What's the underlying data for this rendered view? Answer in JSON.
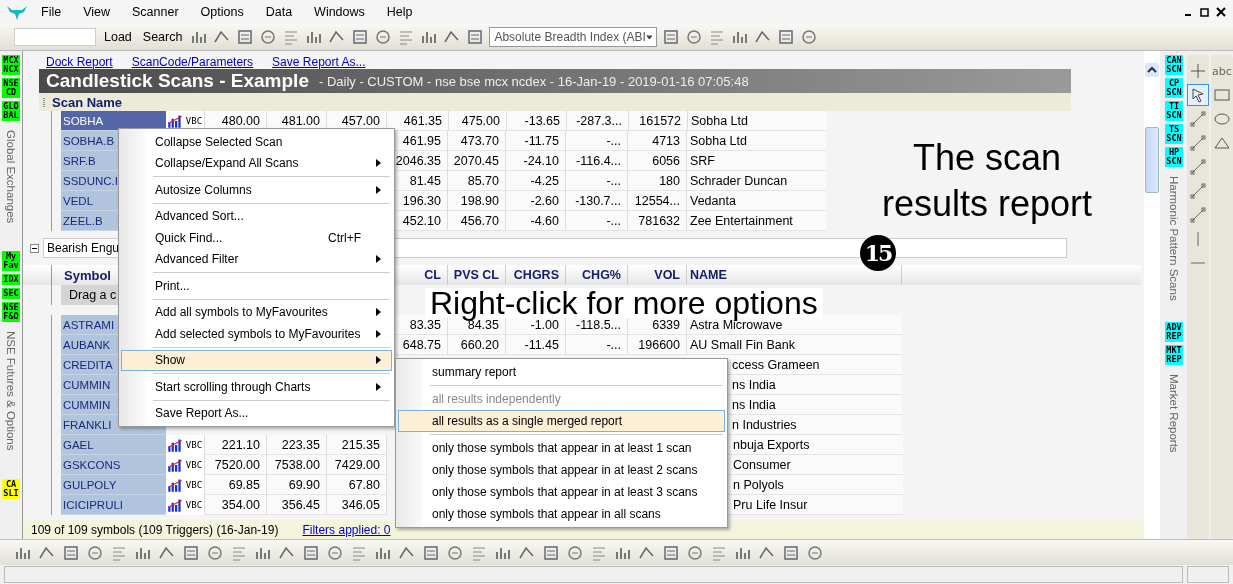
{
  "menu_bar": {
    "items": [
      "File",
      "View",
      "Scanner",
      "Options",
      "Data",
      "Windows",
      "Help"
    ]
  },
  "toolbar": {
    "buttons": [
      "Load",
      "Search"
    ],
    "indicator_dropdown": {
      "value": "Absolute Breadth Index (ABI"
    }
  },
  "left_panel": {
    "groups": [
      {
        "buttons": [
          {
            "label": "MCX NCX",
            "color": "#00ff00"
          },
          {
            "label": "NSE CD",
            "color": "#00ff00"
          },
          {
            "label": "GLO BAL",
            "color": "#00ff00"
          }
        ],
        "caption": "Global Exchanges"
      },
      {
        "buttons": [
          {
            "label": "My Fav",
            "color": "#00ff00"
          },
          {
            "label": "IDX",
            "color": "#00ff00"
          },
          {
            "label": "SEC",
            "color": "#00ff00"
          },
          {
            "label": "NSE F&O",
            "color": "#00ff00"
          }
        ],
        "caption": "NSE Futures & Options"
      },
      {
        "buttons": [
          {
            "label": "CA SLI",
            "color": "#ffff00"
          }
        ]
      }
    ]
  },
  "report": {
    "links": [
      "Dock Report",
      "ScanCode/Parameters",
      "Save Report As..."
    ],
    "title": "Candlestick Scans - Example",
    "subtitle": "- Daily - CUSTOM - nse bse mcx ncdex - 16-Jan-19 - 2019-01-16 07:05:48",
    "column_header": "Scan Name",
    "first_group": {
      "rows": [
        {
          "symbol": "SOBHA",
          "selected": true,
          "chart_link": "VBC",
          "o": "480.00",
          "h": "481.00",
          "l": "457.00",
          "cl": "461.35",
          "pvs": "475.00",
          "chg": "-13.65",
          "pct": "-287.3...",
          "vol": "161572",
          "name": "Sobha Ltd"
        },
        {
          "symbol": "SOBHA.B",
          "selected": false,
          "cl": "461.95",
          "pvs": "473.70",
          "chg": "-11.75",
          "pct": "-...",
          "vol": "4713",
          "name": "Sobha Ltd"
        },
        {
          "symbol": "SRF.B",
          "selected": false,
          "cl": "2046.35",
          "pvs": "2070.45",
          "chg": "-24.10",
          "pct": "-116.4...",
          "vol": "6056",
          "name": "SRF"
        },
        {
          "symbol": "SSDUNC.I",
          "selected": false,
          "cl": "81.45",
          "pvs": "85.70",
          "chg": "-4.25",
          "pct": "-...",
          "vol": "180",
          "name": "Schrader Duncan"
        },
        {
          "symbol": "VEDL",
          "selected": false,
          "cl": "196.30",
          "pvs": "198.90",
          "chg": "-2.60",
          "pct": "-130.7...",
          "vol": "12554...",
          "name": "Vedanta"
        },
        {
          "symbol": "ZEEL.B",
          "selected": false,
          "cl": "452.10",
          "pvs": "456.70",
          "chg": "-4.60",
          "pct": "-...",
          "vol": "781632",
          "name": "Zee Entertainment"
        }
      ]
    },
    "second_group": {
      "title": "Bearish Engu",
      "expanded": true,
      "symbol_header": "Symbol",
      "columns": [
        "CL",
        "PVS CL",
        "CHGRS",
        "CHG%",
        "VOL",
        "NAME"
      ],
      "drag_hint": "Drag a c",
      "rows": [
        {
          "symbol": "ASTRAMI",
          "selected": false,
          "cl": "83.35",
          "pvs": "84.35",
          "chg": "-1.00",
          "pct": "-118.5...",
          "vol": "6339",
          "name": "Astra Microwave"
        },
        {
          "symbol": "AUBANK",
          "selected": false,
          "cl": "648.75",
          "pvs": "660.20",
          "chg": "-11.45",
          "pct": "-...",
          "vol": "196600",
          "name": "AU Small Fin Bank"
        },
        {
          "symbol": "CREDITA",
          "selected": false,
          "name": "ccess Grameen"
        },
        {
          "symbol": "CUMMIN",
          "selected": false,
          "name": "ns India"
        },
        {
          "symbol": "CUMMIN",
          "selected": false,
          "name": "ns India"
        },
        {
          "symbol": "FRANKLI",
          "selected": false,
          "name": "n Industries"
        },
        {
          "symbol": "GAEL",
          "selected": false,
          "chart_link": "VBC",
          "o": "221.10",
          "h": "223.35",
          "l": "215.35",
          "name": "nbuja Exports"
        },
        {
          "symbol": "GSKCONS",
          "selected": false,
          "chart_link": "VBC",
          "o": "7520.00",
          "h": "7538.00",
          "l": "7429.00",
          "name": "Consumer"
        },
        {
          "symbol": "GULPOLY",
          "selected": false,
          "chart_link": "VBC",
          "o": "69.85",
          "h": "69.90",
          "l": "67.80",
          "name": "n Polyols"
        },
        {
          "symbol": "ICICIPRULI",
          "selected": false,
          "chart_link": "VBC",
          "o": "354.00",
          "h": "356.45",
          "l": "346.05",
          "name": "Pru Life Insur"
        }
      ]
    },
    "status": {
      "summary": "109 of 109 symbols (109 Triggers) (16-Jan-19)",
      "filter_link": "Filters applied: 0"
    }
  },
  "right_panel": {
    "scan_tabs": [
      {
        "label": "CAN SCN",
        "color": "#00ffff"
      },
      {
        "label": "CP SCN",
        "color": "#00ffff"
      },
      {
        "label": "TI SCN",
        "color": "#00ffff"
      },
      {
        "label": "TS SCN",
        "color": "#00ffff"
      },
      {
        "label": "HP SCN",
        "color": "#00ffff"
      }
    ],
    "scan_caption": "Harmonic Pattern Scans",
    "report_tabs": [
      {
        "label": "ADV REP",
        "color": "#00ffff"
      },
      {
        "label": "MKT REP",
        "color": "#00ffff"
      }
    ],
    "report_caption": "Market Reports",
    "tools": [
      {
        "kind": "plus",
        "selected": false
      },
      {
        "kind": "pointer",
        "selected": true
      },
      {
        "kind": "line",
        "selected": false
      },
      {
        "kind": "line",
        "selected": false
      },
      {
        "kind": "line",
        "selected": false
      },
      {
        "kind": "line",
        "selected": false
      },
      {
        "kind": "line",
        "selected": false
      },
      {
        "kind": "vline",
        "selected": false
      },
      {
        "kind": "hline",
        "selected": false
      }
    ],
    "shape_tools": [
      {
        "kind": "text",
        "label": "abc"
      },
      {
        "kind": "rect"
      },
      {
        "kind": "ellipse"
      },
      {
        "kind": "triangle"
      }
    ]
  },
  "context_menu": {
    "groups": [
      {
        "items": [
          {
            "label": "Collapse Selected Scan",
            "submenu": false,
            "selected": false
          },
          {
            "label": "Collapse/Expand All Scans",
            "submenu": true,
            "selected": false
          }
        ]
      },
      {
        "items": [
          {
            "label": "Autosize Columns",
            "submenu": true,
            "selected": false
          }
        ]
      },
      {
        "items": [
          {
            "label": "Advanced Sort...",
            "submenu": false,
            "selected": false
          },
          {
            "label": "Quick Find...",
            "shortcut": "Ctrl+F",
            "submenu": false,
            "selected": false
          },
          {
            "label": "Advanced Filter",
            "submenu": true,
            "selected": false
          }
        ]
      },
      {
        "items": [
          {
            "label": "Print...",
            "submenu": false,
            "selected": false
          }
        ]
      },
      {
        "items": [
          {
            "label": "Add all symbols to MyFavourites",
            "submenu": true,
            "selected": false
          },
          {
            "label": "Add selected symbols to MyFavourites",
            "submenu": true,
            "selected": false
          }
        ]
      },
      {
        "items": [
          {
            "label": "Show",
            "submenu": true,
            "selected": true
          }
        ]
      },
      {
        "items": [
          {
            "label": "Start scrolling through Charts",
            "submenu": true,
            "selected": false
          }
        ]
      },
      {
        "items": [
          {
            "label": "Save Report As...",
            "submenu": false,
            "selected": false
          }
        ]
      }
    ]
  },
  "submenu": {
    "groups": [
      {
        "items": [
          {
            "label": "summary report",
            "disabled": false,
            "selected": false
          }
        ]
      },
      {
        "items": [
          {
            "label": "all results independently",
            "disabled": true,
            "selected": false
          },
          {
            "label": "all results as a single merged report",
            "disabled": false,
            "selected": true
          }
        ]
      },
      {
        "items": [
          {
            "label": "only those symbols that appear in at least 1 scan",
            "disabled": false,
            "selected": false
          },
          {
            "label": "only those symbols that appear in at least 2 scans",
            "disabled": false,
            "selected": false
          },
          {
            "label": "only those symbols that appear in at least 3 scans",
            "disabled": false,
            "selected": false
          },
          {
            "label": "only those symbols that appear in all scans",
            "disabled": false,
            "selected": false
          }
        ]
      }
    ]
  },
  "annotations": {
    "menu_note": "Right-click for more options",
    "report_note": "The scan results report",
    "step_badge": "15"
  }
}
